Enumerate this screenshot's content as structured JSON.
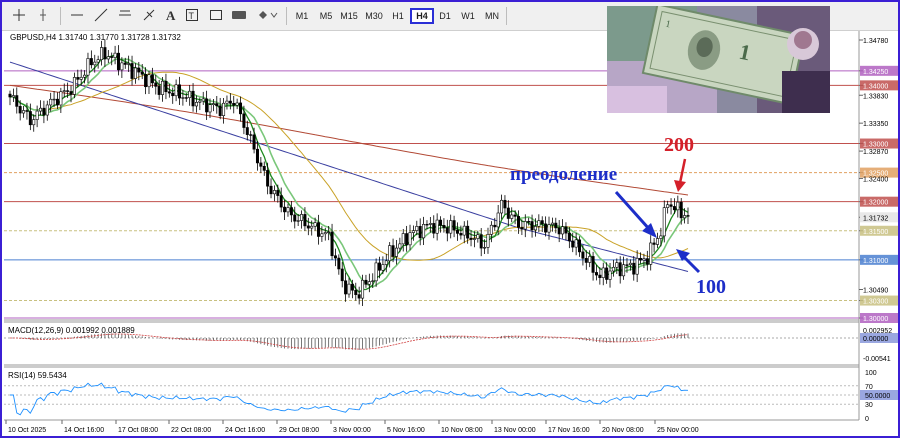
{
  "toolbar": {
    "tools": [
      "crosshair-icon",
      "vertical-line-icon",
      "horizontal-line-icon",
      "trendline-icon",
      "channel-icon",
      "fibonacci-icon",
      "text-icon",
      "label-icon",
      "shapes-icon",
      "arrows-icon"
    ],
    "timeframes": [
      "M1",
      "M5",
      "M15",
      "M30",
      "H1",
      "H4",
      "D1",
      "W1",
      "MN"
    ],
    "active_timeframe": "H4"
  },
  "chart": {
    "symbol_header": "GBPUSD,H4  1.31740 1.31770 1.31728 1.31732",
    "annotation_overcome": "преодоление",
    "annotation_200": "200",
    "annotation_100": "100",
    "price_axis": [
      "1.34780",
      "1.34250",
      "1.34000",
      "1.33830",
      "1.33350",
      "1.33000",
      "1.32870",
      "1.32500",
      "1.32400",
      "1.32000",
      "1.31732",
      "1.31500",
      "1.31000",
      "1.30490",
      "1.30300",
      "1.30000"
    ],
    "current_price": "1.31732",
    "time_axis": [
      "10 Oct 2025",
      "14 Oct 16:00",
      "17 Oct 08:00",
      "22 Oct 08:00",
      "24 Oct 16:00",
      "29 Oct 08:00",
      "3 Nov 00:00",
      "5 Nov 16:00",
      "10 Nov 08:00",
      "13 Nov 00:00",
      "17 Nov 16:00",
      "20 Nov 08:00",
      "25 Nov 00:00"
    ],
    "horizontal_levels": [
      1.3425,
      1.34,
      1.33,
      1.325,
      1.32,
      1.315,
      1.31,
      1.303,
      1.3
    ]
  },
  "macd": {
    "label": "MACD(12,26,9) 0.001992 0.001889",
    "axis": [
      "0.002952",
      "0.00000",
      "-0.00541"
    ]
  },
  "rsi": {
    "label": "RSI(14) 59.5434",
    "axis": [
      "100",
      "70",
      "50.0000",
      "30",
      "0"
    ]
  },
  "colors": {
    "frame": "#3b1fd4",
    "ma200": "#b24a36",
    "ma100": "#3a3fa0",
    "ma_orange": "#c9a227",
    "ma_green_fast": "#1f8a1f",
    "ma_green_slow": "#7ac77a",
    "annotation_red": "#d4202a",
    "annotation_blue": "#1d2ec8",
    "level_red": "#c0504d",
    "level_purple": "#b060c0",
    "level_blue": "#4a7fd0",
    "level_orange": "#e0a060"
  }
}
